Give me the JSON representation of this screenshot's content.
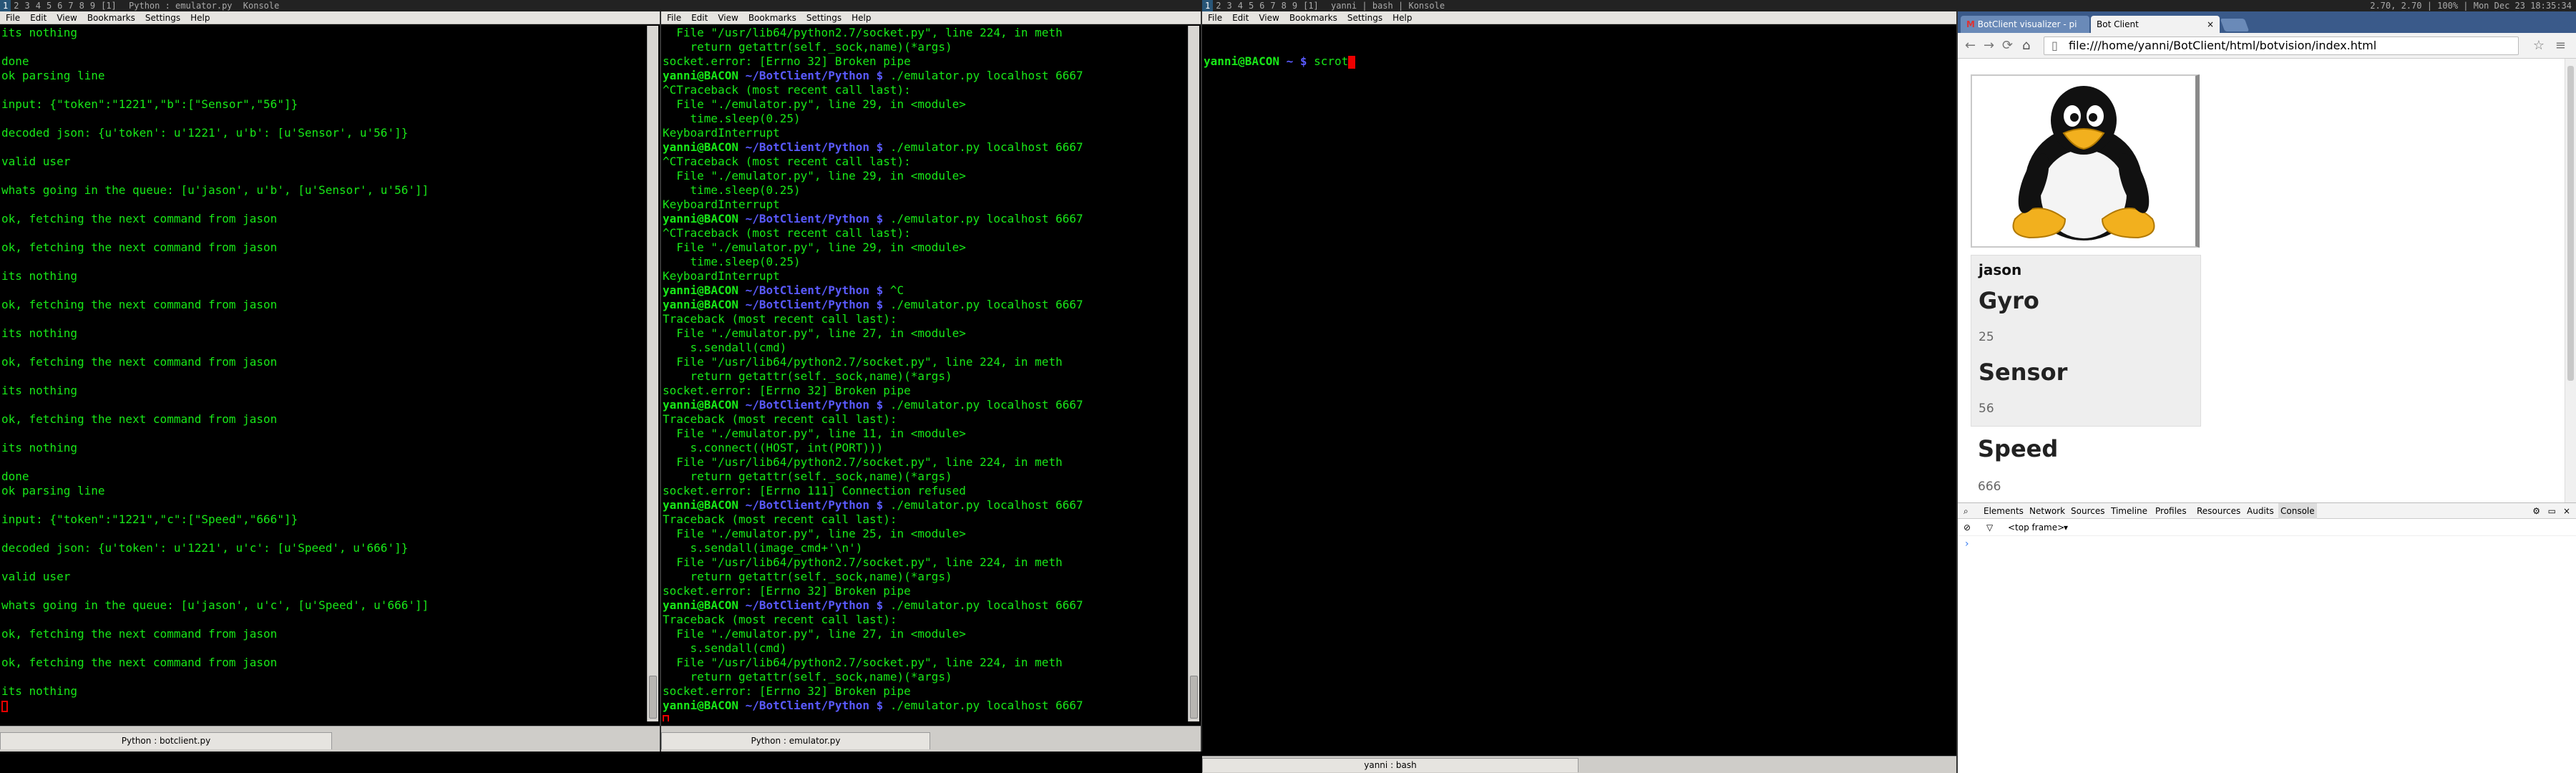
{
  "wm_left": {
    "tags": [
      "1",
      "2",
      "3",
      "4",
      "5",
      "6",
      "7",
      "8",
      "9",
      "[1]"
    ],
    "title": "Python : emulator.py",
    "app": "Konsole"
  },
  "wm_right": {
    "tags": [
      "1",
      "2",
      "3",
      "4",
      "5",
      "6",
      "7",
      "8",
      "9",
      "[1]"
    ],
    "title1": "yanni",
    "title2": "bash",
    "app": "Konsole",
    "status": "2.70, 2.70 | 100% | Mon Dec 23 18:35:34"
  },
  "menu": [
    "File",
    "Edit",
    "View",
    "Bookmarks",
    "Settings",
    "Help"
  ],
  "term1": {
    "lines": [
      "its nothing",
      "",
      "done",
      "ok parsing line",
      "",
      "input: {\"token\":\"1221\",\"b\":[\"Sensor\",\"56\"]}",
      "",
      "decoded json: {u'token': u'1221', u'b': [u'Sensor', u'56']}",
      "",
      "valid user",
      "",
      "whats going in the queue: [u'jason', u'b', [u'Sensor', u'56']]",
      "",
      "ok, fetching the next command from jason",
      "",
      "ok, fetching the next command from jason",
      "",
      "its nothing",
      "",
      "ok, fetching the next command from jason",
      "",
      "its nothing",
      "",
      "ok, fetching the next command from jason",
      "",
      "its nothing",
      "",
      "ok, fetching the next command from jason",
      "",
      "its nothing",
      "",
      "done",
      "ok parsing line",
      "",
      "input: {\"token\":\"1221\",\"c\":[\"Speed\",\"666\"]}",
      "",
      "decoded json: {u'token': u'1221', u'c': [u'Speed', u'666']}",
      "",
      "valid user",
      "",
      "whats going in the queue: [u'jason', u'c', [u'Speed', u'666']]",
      "",
      "ok, fetching the next command from jason",
      "",
      "ok, fetching the next command from jason",
      "",
      "its nothing"
    ],
    "tab_label": "Python : botclient.py"
  },
  "term2": {
    "prompt_user": "yanni@BACON",
    "prompt_path": "~/BotClient/Python $",
    "lines": [
      {
        "t": "  File \"/usr/lib64/python2.7/socket.py\", line 224, in meth"
      },
      {
        "t": "    return getattr(self._sock,name)(*args)"
      },
      {
        "t": "socket.error: [Errno 32] Broken pipe"
      },
      {
        "p": true,
        "t": " ./emulator.py localhost 6667"
      },
      {
        "t": "^CTraceback (most recent call last):"
      },
      {
        "t": "  File \"./emulator.py\", line 29, in <module>"
      },
      {
        "t": "    time.sleep(0.25)"
      },
      {
        "t": "KeyboardInterrupt"
      },
      {
        "p": true,
        "t": " ./emulator.py localhost 6667"
      },
      {
        "t": "^CTraceback (most recent call last):"
      },
      {
        "t": "  File \"./emulator.py\", line 29, in <module>"
      },
      {
        "t": "    time.sleep(0.25)"
      },
      {
        "t": "KeyboardInterrupt"
      },
      {
        "p": true,
        "t": " ./emulator.py localhost 6667"
      },
      {
        "t": "^CTraceback (most recent call last):"
      },
      {
        "t": "  File \"./emulator.py\", line 29, in <module>"
      },
      {
        "t": "    time.sleep(0.25)"
      },
      {
        "t": "KeyboardInterrupt"
      },
      {
        "p": true,
        "t": " ^C"
      },
      {
        "p": true,
        "t": " ./emulator.py localhost 6667"
      },
      {
        "t": "Traceback (most recent call last):"
      },
      {
        "t": "  File \"./emulator.py\", line 27, in <module>"
      },
      {
        "t": "    s.sendall(cmd)"
      },
      {
        "t": "  File \"/usr/lib64/python2.7/socket.py\", line 224, in meth"
      },
      {
        "t": "    return getattr(self._sock,name)(*args)"
      },
      {
        "t": "socket.error: [Errno 32] Broken pipe"
      },
      {
        "p": true,
        "t": " ./emulator.py localhost 6667"
      },
      {
        "t": "Traceback (most recent call last):"
      },
      {
        "t": "  File \"./emulator.py\", line 11, in <module>"
      },
      {
        "t": "    s.connect((HOST, int(PORT)))"
      },
      {
        "t": "  File \"/usr/lib64/python2.7/socket.py\", line 224, in meth"
      },
      {
        "t": "    return getattr(self._sock,name)(*args)"
      },
      {
        "t": "socket.error: [Errno 111] Connection refused"
      },
      {
        "p": true,
        "t": " ./emulator.py localhost 6667"
      },
      {
        "t": "Traceback (most recent call last):"
      },
      {
        "t": "  File \"./emulator.py\", line 25, in <module>"
      },
      {
        "t": "    s.sendall(image_cmd+'\\n')"
      },
      {
        "t": "  File \"/usr/lib64/python2.7/socket.py\", line 224, in meth"
      },
      {
        "t": "    return getattr(self._sock,name)(*args)"
      },
      {
        "t": "socket.error: [Errno 32] Broken pipe"
      },
      {
        "p": true,
        "t": " ./emulator.py localhost 6667"
      },
      {
        "t": "Traceback (most recent call last):"
      },
      {
        "t": "  File \"./emulator.py\", line 27, in <module>"
      },
      {
        "t": "    s.sendall(cmd)"
      },
      {
        "t": "  File \"/usr/lib64/python2.7/socket.py\", line 224, in meth"
      },
      {
        "t": "    return getattr(self._sock,name)(*args)"
      },
      {
        "t": "socket.error: [Errno 32] Broken pipe"
      },
      {
        "p": true,
        "t": " ./emulator.py localhost 6667"
      }
    ],
    "tab_label": "Python : emulator.py"
  },
  "term3": {
    "prompt_user": "yanni@BACON",
    "prompt_path": "~ $",
    "command": " scrot",
    "tab_label": "yanni : bash"
  },
  "browser": {
    "tab1": "BotClient visualizer - pi",
    "tab2": "Bot Client",
    "url": "file:///home/yanni/BotClient/html/botvision/index.html",
    "user": "jason",
    "sensors": [
      {
        "name": "Gyro",
        "value": "25"
      },
      {
        "name": "Sensor",
        "value": "56"
      },
      {
        "name": "Speed",
        "value": "666"
      }
    ],
    "devtools": {
      "tabs": [
        "Elements",
        "Network",
        "Sources",
        "Timeline",
        "Profiles",
        "Resources",
        "Audits",
        "Console"
      ],
      "frame": "<top frame>",
      "caret": "›"
    }
  },
  "colors": {
    "term_green": "#18e818",
    "prompt_blue": "#5a5aff",
    "cursor_red": "#e00000"
  }
}
